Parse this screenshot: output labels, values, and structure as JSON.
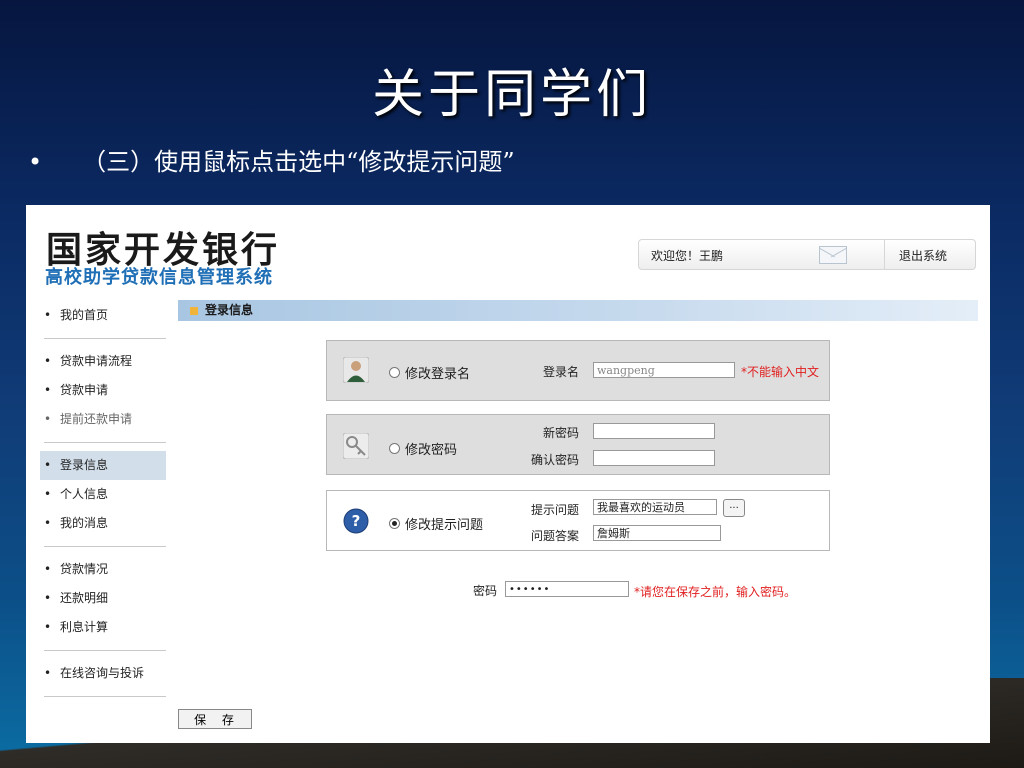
{
  "slide": {
    "title": "关于同学们",
    "bullet_symbol": "•",
    "bullet_text": "（三）使用鼠标点击选中“修改提示问题”"
  },
  "app": {
    "bank_name": "国家开发银行",
    "system_name": "高校助学贷款信息管理系统"
  },
  "topbar": {
    "welcome": "欢迎您！王鹏",
    "mail_icon": "mail-icon",
    "logout": "退出系统"
  },
  "sidebar": {
    "groups": [
      [
        "我的首页"
      ],
      [
        "贷款申请流程",
        "贷款申请",
        "提前还款申请"
      ],
      [
        "登录信息",
        "个人信息",
        "我的消息"
      ],
      [
        "贷款情况",
        "还款明细",
        "利息计算"
      ],
      [
        "在线咨询与投诉"
      ]
    ],
    "active": "登录信息",
    "muted": "提前还款申请"
  },
  "section": {
    "title": "登录信息"
  },
  "login_name_panel": {
    "icon": "user-icon",
    "radio_label": "修改登录名",
    "field_label": "登录名",
    "field_value": "wangpeng",
    "hint": "*不能输入中文",
    "selected": false
  },
  "password_panel": {
    "icon": "key-icon",
    "radio_label": "修改密码",
    "new_label": "新密码",
    "new_value": "",
    "confirm_label": "确认密码",
    "confirm_value": "",
    "selected": false
  },
  "question_panel": {
    "icon": "question-icon",
    "radio_label": "修改提示问题",
    "question_label": "提示问题",
    "question_value": "我最喜欢的运动员",
    "more_button": "...",
    "answer_label": "问题答案",
    "answer_value": "詹姆斯",
    "selected": true
  },
  "password_confirm": {
    "label": "密码",
    "value": "••••••",
    "hint": "*请您在保存之前，输入密码。"
  },
  "save_button": "保 存",
  "colors": {
    "accent_blue": "#1f6fb6",
    "hint_red": "#e02020",
    "active_nav": "#d2deea"
  }
}
